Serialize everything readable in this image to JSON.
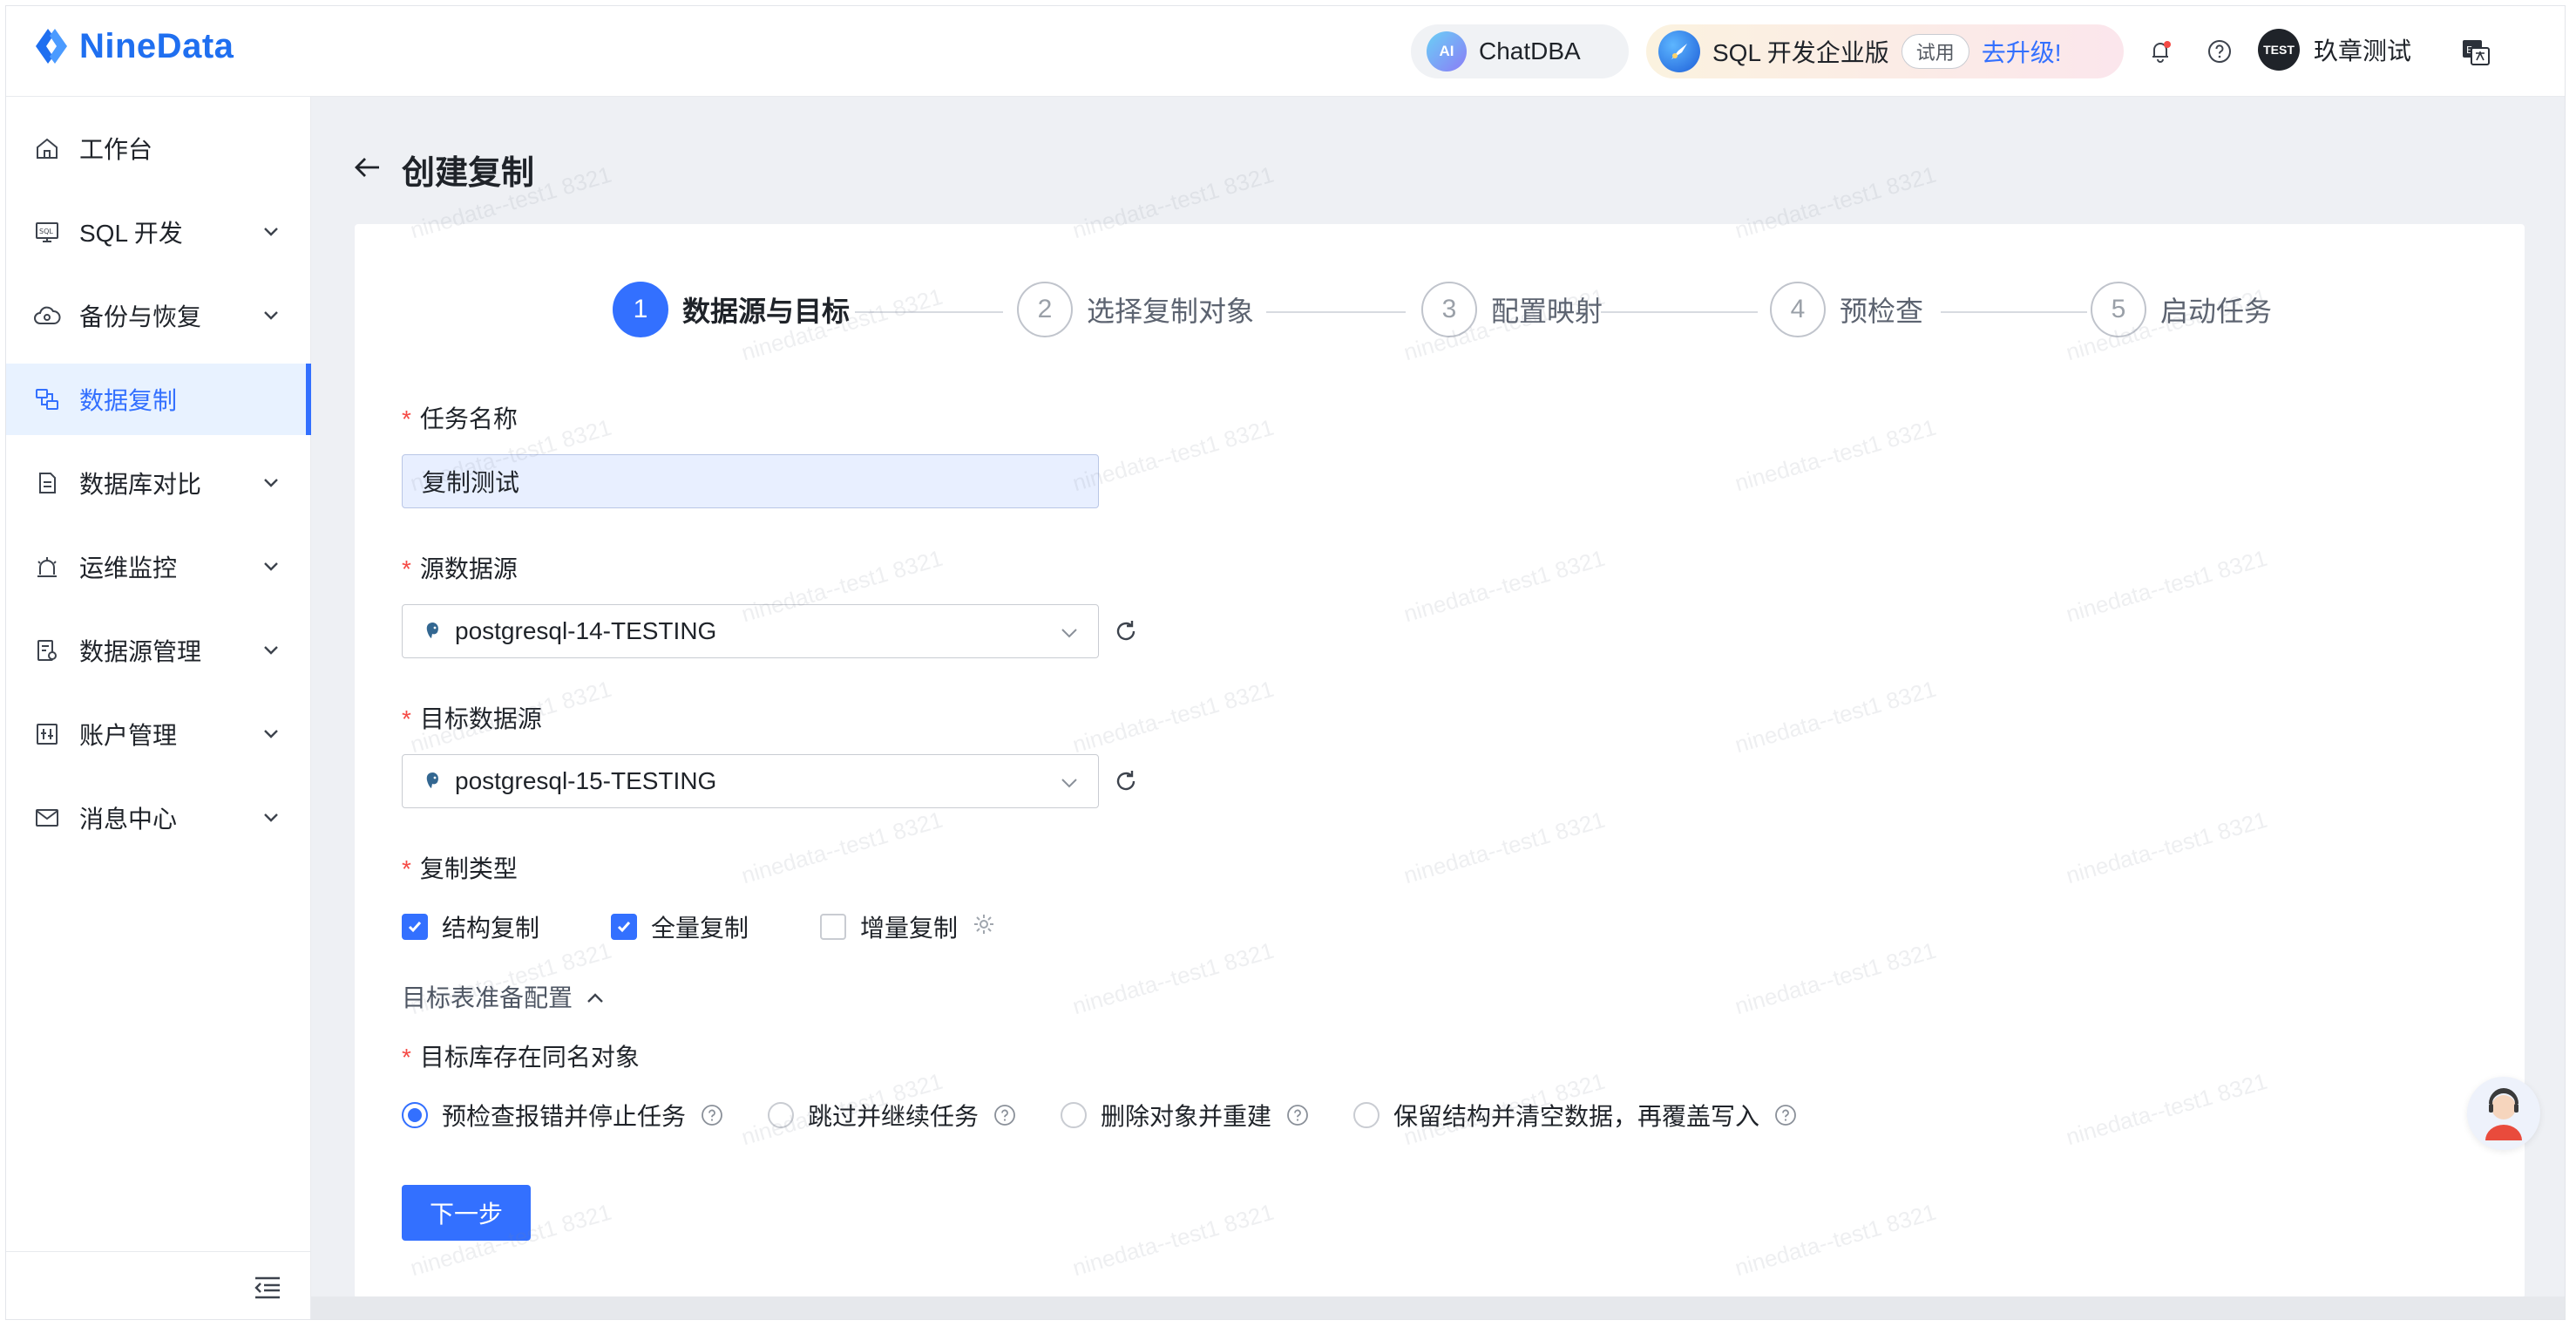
{
  "app": {
    "name": "NineData"
  },
  "header": {
    "chatdba_badge": "AI",
    "chatdba_label": "ChatDBA",
    "edition_label": "SQL 开发企业版",
    "trial_tag": "试用",
    "upgrade_label": "去升级!",
    "user_avatar": "TEST",
    "user_name": "玖章测试"
  },
  "sidebar": {
    "items": [
      {
        "label": "工作台",
        "icon": "home-icon",
        "expandable": false
      },
      {
        "label": "SQL 开发",
        "icon": "sql-icon",
        "expandable": true
      },
      {
        "label": "备份与恢复",
        "icon": "cloud-backup-icon",
        "expandable": true
      },
      {
        "label": "数据复制",
        "icon": "replication-icon",
        "expandable": false,
        "active": true
      },
      {
        "label": "数据库对比",
        "icon": "compare-icon",
        "expandable": true
      },
      {
        "label": "运维监控",
        "icon": "alarm-icon",
        "expandable": true
      },
      {
        "label": "数据源管理",
        "icon": "datasource-icon",
        "expandable": true
      },
      {
        "label": "账户管理",
        "icon": "account-icon",
        "expandable": true
      },
      {
        "label": "消息中心",
        "icon": "mail-icon",
        "expandable": true
      }
    ]
  },
  "page": {
    "title": "创建复制"
  },
  "steps": [
    {
      "num": "1",
      "label": "数据源与目标",
      "active": true
    },
    {
      "num": "2",
      "label": "选择复制对象"
    },
    {
      "num": "3",
      "label": "配置映射"
    },
    {
      "num": "4",
      "label": "预检查"
    },
    {
      "num": "5",
      "label": "启动任务"
    }
  ],
  "form": {
    "required_mark": "*",
    "task_name_label": "任务名称",
    "task_name_value": "复制测试",
    "source_label": "源数据源",
    "source_value": "postgresql-14-TESTING",
    "target_label": "目标数据源",
    "target_value": "postgresql-15-TESTING",
    "type_label": "复制类型",
    "types": [
      {
        "label": "结构复制",
        "checked": true
      },
      {
        "label": "全量复制",
        "checked": true
      },
      {
        "label": "增量复制",
        "checked": false
      }
    ],
    "prep_config_label": "目标表准备配置",
    "conflict_label": "目标库存在同名对象",
    "conflict_options": [
      {
        "label": "预检查报错并停止任务",
        "selected": true
      },
      {
        "label": "跳过并继续任务",
        "selected": false
      },
      {
        "label": "删除对象并重建",
        "selected": false
      },
      {
        "label": "保留结构并清空数据，再覆盖写入",
        "selected": false
      }
    ],
    "next_button": "下一步"
  },
  "watermark": "ninedata--test1 8321",
  "colors": {
    "accent": "#3370ff",
    "required": "#f54a45",
    "active_bg": "#e8f2ff"
  }
}
